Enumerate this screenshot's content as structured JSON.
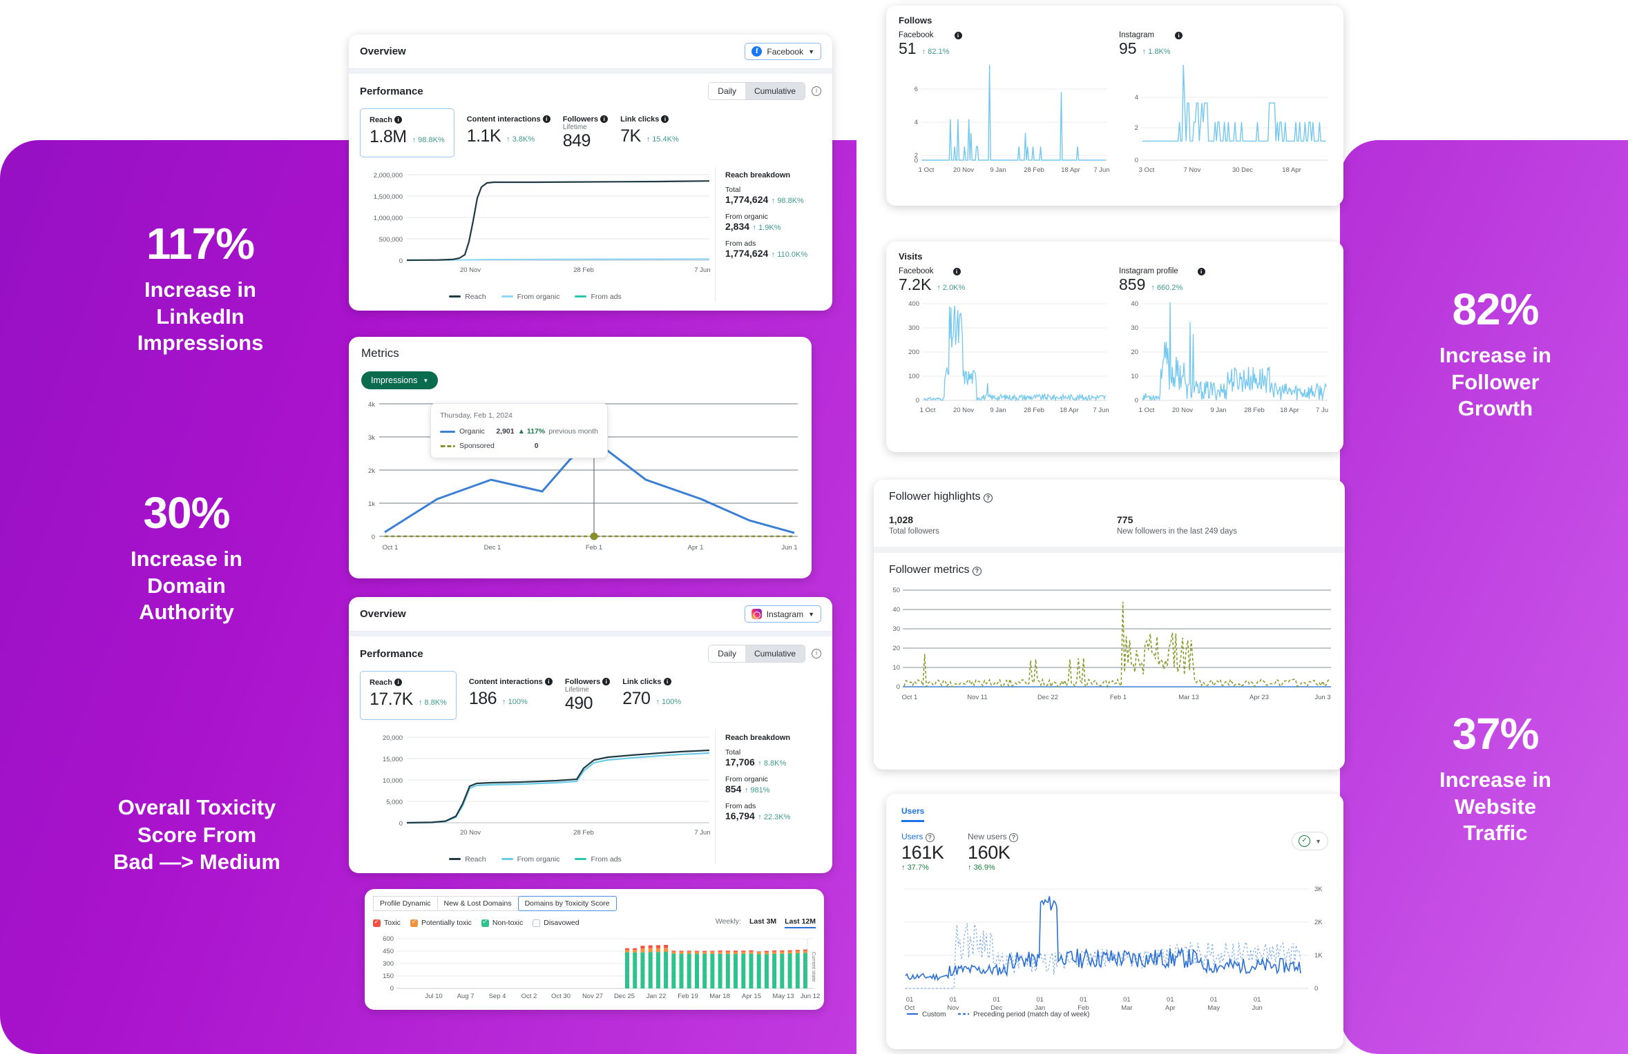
{
  "highlights": [
    {
      "id": "117",
      "big": "117%",
      "lines": [
        "Increase in",
        "LinkedIn",
        "Impressions"
      ]
    },
    {
      "id": "30",
      "big": "30%",
      "lines": [
        "Increase in",
        "Domain",
        "Authority"
      ]
    },
    {
      "id": "82",
      "big": "82%",
      "lines": [
        "Increase in",
        "Follower",
        "Growth"
      ]
    },
    {
      "id": "37",
      "big": "37%",
      "lines": [
        "Increase in",
        "Website",
        "Traffic"
      ]
    }
  ],
  "toxicity_statement": [
    "Overall Toxicity",
    "Score From",
    "Bad —> Medium"
  ],
  "facebook_overview": {
    "title": "Overview",
    "network": "Facebook",
    "section": "Performance",
    "toggle": {
      "daily": "Daily",
      "cumulative": "Cumulative",
      "active": "Cumulative"
    },
    "kpis": [
      {
        "label": "Reach",
        "sublabel": "",
        "value": "1.8M",
        "delta": "98.8K%"
      },
      {
        "label": "Content interactions",
        "sublabel": "",
        "value": "1.1K",
        "delta": "3.8K%"
      },
      {
        "label": "Followers",
        "sublabel": "Lifetime",
        "value": "849",
        "delta": ""
      },
      {
        "label": "Link clicks",
        "sublabel": "",
        "value": "7K",
        "delta": "15.4K%"
      }
    ],
    "breakdown": {
      "title": "Reach breakdown",
      "rows": [
        {
          "label": "Total",
          "value": "1,774,624",
          "delta": "98.8K%"
        },
        {
          "label": "From organic",
          "value": "2,834",
          "delta": "1.9K%"
        },
        {
          "label": "From ads",
          "value": "1,774,624",
          "delta": "110.0K%"
        }
      ]
    },
    "legend": [
      "Reach",
      "From organic",
      "From ads"
    ],
    "chart_data": {
      "type": "line",
      "title": "Reach (cumulative)",
      "xlabel": "",
      "ylabel": "",
      "yticks": [
        "0",
        "500,000",
        "1,000,000",
        "1,500,000",
        "2,000,000"
      ],
      "ylim": [
        0,
        2000000
      ],
      "xticks": [
        "20 Nov",
        "28 Feb",
        "7 Jun"
      ],
      "series": [
        {
          "name": "Reach",
          "color": "#1f3a42",
          "values": [
            2000,
            4000,
            7000,
            12000,
            18000,
            26000,
            40000,
            70000,
            420000,
            1060000,
            1420000,
            1600000,
            1700000,
            1742000,
            1745000,
            1746000,
            1748000,
            1750000,
            1752000,
            1754000,
            1756000,
            1758000,
            1760000,
            1762000,
            1764000,
            1766000,
            1768000,
            1770000,
            1772000,
            1774624
          ]
        },
        {
          "name": "From organic",
          "color": "#8ed6f7",
          "values": [
            100,
            160,
            230,
            300,
            380,
            460,
            540,
            640,
            760,
            900,
            1050,
            1200,
            1340,
            1470,
            1600,
            1720,
            1840,
            1960,
            2080,
            2180,
            2280,
            2380,
            2460,
            2540,
            2610,
            2670,
            2720,
            2770,
            2810,
            2834
          ]
        },
        {
          "name": "From ads",
          "color": "#2cc5b0",
          "values": [
            0,
            0,
            0,
            0,
            0,
            0,
            0,
            0,
            0,
            0,
            0,
            0,
            0,
            0,
            0,
            0,
            0,
            0,
            0,
            0,
            0,
            0,
            0,
            0,
            0,
            0,
            0,
            0,
            0,
            0
          ]
        }
      ]
    }
  },
  "metrics_card": {
    "title": "Metrics",
    "selector": "Impressions",
    "tooltip": {
      "date": "Thursday, Feb 1, 2024",
      "rows": [
        {
          "name": "Organic",
          "value": "2,901",
          "delta": "117%",
          "note": "previous month"
        },
        {
          "name": "Sponsored",
          "value": "0",
          "delta": "",
          "note": ""
        }
      ]
    },
    "chart_data": {
      "type": "line",
      "title": "Impressions",
      "yticks": [
        "0",
        "1k",
        "2k",
        "3k",
        "4k"
      ],
      "ylim": [
        0,
        4000
      ],
      "xticks": [
        "Oct 1",
        "Dec 1",
        "Feb 1",
        "Apr 1",
        "Jun 1"
      ],
      "x": [
        "Oct 1",
        "Nov 1",
        "Dec 1",
        "Jan 1",
        "Jan 15",
        "Feb 1",
        "Mar 1",
        "Apr 1",
        "May 1",
        "Jun 1"
      ],
      "series": [
        {
          "name": "Organic",
          "color": "#3b7fd4",
          "style": "solid",
          "values": [
            120,
            1130,
            1700,
            1350,
            2320,
            2901,
            1700,
            1200,
            600,
            170
          ]
        },
        {
          "name": "Sponsored",
          "color": "#8a8f2e",
          "style": "dashed",
          "values": [
            0,
            0,
            0,
            0,
            0,
            0,
            0,
            0,
            0,
            0
          ]
        }
      ]
    }
  },
  "instagram_overview": {
    "title": "Overview",
    "network": "Instagram",
    "section": "Performance",
    "toggle": {
      "daily": "Daily",
      "cumulative": "Cumulative",
      "active": "Cumulative"
    },
    "kpis": [
      {
        "label": "Reach",
        "sublabel": "",
        "value": "17.7K",
        "delta": "8.8K%"
      },
      {
        "label": "Content interactions",
        "sublabel": "",
        "value": "186",
        "delta": "100%"
      },
      {
        "label": "Followers",
        "sublabel": "Lifetime",
        "value": "490",
        "delta": ""
      },
      {
        "label": "Link clicks",
        "sublabel": "",
        "value": "270",
        "delta": "100%"
      }
    ],
    "breakdown": {
      "title": "Reach breakdown",
      "rows": [
        {
          "label": "Total",
          "value": "17,706",
          "delta": "8.8K%"
        },
        {
          "label": "From organic",
          "value": "854",
          "delta": "981%"
        },
        {
          "label": "From ads",
          "value": "16,794",
          "delta": "22.3K%"
        }
      ]
    },
    "legend": [
      "Reach",
      "From organic",
      "From ads"
    ],
    "chart_data": {
      "type": "line",
      "title": "Reach (cumulative)",
      "yticks": [
        "0",
        "5,000",
        "10,000",
        "15,000",
        "20,000"
      ],
      "ylim": [
        0,
        20000
      ],
      "xticks": [
        "20 Nov",
        "28 Feb",
        "7 Jun"
      ],
      "series": [
        {
          "name": "Reach",
          "color": "#1f3a42",
          "values": [
            20,
            60,
            160,
            420,
            1800,
            6800,
            9200,
            9600,
            9800,
            9950,
            10100,
            10300,
            10500,
            10800,
            11100,
            11500,
            13600,
            15200,
            16000,
            16400,
            16800,
            17000,
            17200,
            17350,
            17450,
            17550,
            17620,
            17660,
            17690,
            17706
          ]
        },
        {
          "name": "From organic",
          "color": "#6ecbe8",
          "values": [
            10,
            35,
            110,
            330,
            1450,
            6100,
            8400,
            8700,
            8900,
            9000,
            9150,
            9300,
            9450,
            9700,
            10000,
            10350,
            12600,
            14200,
            14900,
            15300,
            15700,
            15900,
            16100,
            16250,
            16350,
            16450,
            16520,
            16560,
            16590,
            16620
          ]
        },
        {
          "name": "From ads",
          "color": "#2cc5b0",
          "values": [
            0,
            0,
            0,
            0,
            0,
            0,
            0,
            0,
            0,
            0,
            0,
            0,
            0,
            0,
            0,
            0,
            0,
            0,
            0,
            0,
            0,
            0,
            0,
            0,
            0,
            0,
            0,
            0,
            0,
            0
          ]
        }
      ]
    }
  },
  "toxicity_card": {
    "tabs": [
      "Profile Dynamic",
      "New & Lost Domains",
      "Domains by Toxicity Score"
    ],
    "active_tab": "Domains by Toxicity Score",
    "legend": [
      {
        "label": "Toxic",
        "color": "#f3513f",
        "checked": true
      },
      {
        "label": "Potentially toxic",
        "color": "#f4913e",
        "checked": true
      },
      {
        "label": "Non-toxic",
        "color": "#2ec38c",
        "checked": true
      },
      {
        "label": "Disavowed",
        "color": "#ffffff",
        "checked": false
      }
    ],
    "range_label": "Weekly:",
    "ranges": [
      "Last 3M",
      "Last 12M"
    ],
    "active_range": "Last 12M",
    "current_state_label": "Current state",
    "chart_data": {
      "type": "bar",
      "title": "Domains by Toxicity Score",
      "yticks": [
        "0",
        "150",
        "300",
        "450",
        "600"
      ],
      "ylim": [
        0,
        600
      ],
      "xticks": [
        "Jul 10",
        "Aug 7",
        "Sep 4",
        "Oct 2",
        "Oct 30",
        "Nov 27",
        "Dec 25",
        "Jan 22",
        "Feb 19",
        "Mar 18",
        "Apr 15",
        "May 13",
        "Jun 12"
      ],
      "stacked": true,
      "series": [
        {
          "name": "Toxic",
          "color": "#f3513f",
          "values": [
            18,
            20,
            32,
            34,
            34,
            36,
            12,
            12,
            12,
            12,
            12,
            12,
            14,
            14,
            14,
            14,
            14,
            6,
            14,
            14,
            14,
            14,
            14,
            14
          ]
        },
        {
          "name": "Potentially toxic",
          "color": "#f4913e",
          "values": [
            30,
            32,
            48,
            48,
            48,
            48,
            24,
            24,
            24,
            24,
            24,
            24,
            26,
            26,
            26,
            26,
            26,
            26,
            26,
            26,
            26,
            26,
            26,
            28
          ]
        },
        {
          "name": "Non-toxic",
          "color": "#2ec38c",
          "values": [
            437,
            433,
            435,
            438,
            440,
            442,
            420,
            419,
            420,
            418,
            417,
            418,
            418,
            416,
            416,
            417,
            420,
            415,
            413,
            418,
            419,
            421,
            425,
            428
          ]
        }
      ]
    }
  },
  "follows_card": {
    "title": "Follows",
    "panels": [
      {
        "name": "Facebook",
        "value": "51",
        "delta": "82.1%",
        "chart_data": {
          "type": "line",
          "yticks": [
            "0",
            "2",
            "4",
            "6"
          ],
          "ylim": [
            0,
            7
          ],
          "xticks": [
            "1 Oct",
            "20 Nov",
            "9 Jan",
            "28 Feb",
            "18 Apr",
            "7 Jun"
          ],
          "color": "#74c8f0",
          "peaks": "sparse spikes, max 7 near Dec, 5 near 18 Apr"
        }
      },
      {
        "name": "Instagram",
        "value": "95",
        "delta": "1.8K%",
        "chart_data": {
          "type": "line",
          "yticks": [
            "0",
            "2",
            "4"
          ],
          "ylim": [
            0,
            5
          ],
          "xticks": [
            "3 Oct",
            "7 Nov",
            "30 Dec",
            "18 Apr"
          ],
          "color": "#74c8f0",
          "peaks": "baseline 1, spikes to 5 near late Oct, frequent 2–3"
        }
      }
    ]
  },
  "visits_card": {
    "title": "Visits",
    "panels": [
      {
        "name": "Facebook",
        "value": "7.2K",
        "delta": "2.0K%",
        "chart_data": {
          "type": "line",
          "yticks": [
            "0",
            "100",
            "200",
            "300",
            "400"
          ],
          "ylim": [
            0,
            400
          ],
          "xticks": [
            "1 Oct",
            "20 Nov",
            "9 Jan",
            "28 Feb",
            "18 Apr",
            "7 Jun"
          ],
          "color": "#74c8f0",
          "peaks": "burst to ~390 mid Nov, decays to low noise"
        }
      },
      {
        "name": "Instagram profile",
        "value": "859",
        "delta": "660.2%",
        "chart_data": {
          "type": "line",
          "yticks": [
            "0",
            "10",
            "20",
            "30",
            "40"
          ],
          "ylim": [
            0,
            40
          ],
          "xticks": [
            "1 Oct",
            "20 Nov",
            "9 Jan",
            "28 Feb",
            "18 Apr",
            "7 Ju"
          ],
          "color": "#74c8f0",
          "peaks": "spikes to 40 and 32 around Nov, sustained 5-14 later"
        }
      }
    ]
  },
  "follower_card": {
    "highlights_title": "Follower highlights",
    "stats": [
      {
        "value": "1,028",
        "label": "Total followers"
      },
      {
        "value": "775",
        "label": "New followers in the last 249 days"
      }
    ],
    "metrics_title": "Follower metrics",
    "chart_data": {
      "type": "line",
      "title": "Follower metrics",
      "yticks": [
        "0",
        "10",
        "20",
        "30",
        "40",
        "50"
      ],
      "ylim": [
        0,
        50
      ],
      "xticks": [
        "Oct 1",
        "Nov 11",
        "Dec 22",
        "Feb 1",
        "Mar 13",
        "Apr 23",
        "Jun 3"
      ],
      "series": [
        {
          "name": "New followers",
          "color": "#8a9b2e",
          "style": "dashed",
          "peak": 44,
          "peak_at": "late Jan",
          "values": [
            1,
            2,
            17,
            1,
            2,
            1,
            3,
            2,
            4,
            2,
            3,
            1,
            2,
            1,
            2,
            10,
            3,
            6,
            14,
            7,
            14,
            10,
            6,
            3,
            2,
            1,
            2,
            1,
            44,
            20,
            29,
            12,
            9,
            26,
            8,
            24,
            19,
            6,
            3,
            4,
            2,
            3,
            2,
            1,
            2,
            3,
            1,
            2,
            1,
            2,
            5,
            3,
            1,
            1
          ]
        }
      ]
    }
  },
  "ga_card": {
    "tab": "Users",
    "metrics": [
      {
        "label": "Users",
        "value": "161K",
        "delta": "37.7%"
      },
      {
        "label": "New users",
        "value": "160K",
        "delta": "36.9%"
      }
    ],
    "chart_data": {
      "type": "line",
      "yticks": [
        "0",
        "1K",
        "2K",
        "3K"
      ],
      "ylim": [
        0,
        3000
      ],
      "xticks": [
        {
          "day": "01",
          "month": "Oct"
        },
        {
          "day": "01",
          "month": "Nov"
        },
        {
          "day": "01",
          "month": "Dec"
        },
        {
          "day": "01",
          "month": "Jan"
        },
        {
          "day": "01",
          "month": "Feb"
        },
        {
          "day": "01",
          "month": "Mar"
        },
        {
          "day": "01",
          "month": "Apr"
        },
        {
          "day": "01",
          "month": "May"
        },
        {
          "day": "01",
          "month": "Jun"
        }
      ],
      "series": [
        {
          "name": "Custom",
          "color": "#2b6fd6",
          "style": "solid",
          "values": [
            350,
            420,
            300,
            520,
            600,
            480,
            540,
            700,
            620,
            900,
            1050,
            980,
            1200,
            1100,
            2650,
            2700,
            2500,
            2720,
            2600,
            1000,
            900,
            800,
            850,
            780,
            820,
            760,
            900,
            1100,
            1000,
            1150,
            980,
            1050,
            900,
            880,
            820,
            760,
            700,
            650,
            600,
            560
          ]
        },
        {
          "name": "Preceding period (match day of week)",
          "color": "#7aa7e8",
          "style": "dashed",
          "values": [
            0,
            0,
            0,
            0,
            1400,
            1900,
            1300,
            1100,
            700,
            500,
            400,
            380,
            350,
            900,
            1100,
            1400,
            1300,
            1000,
            900,
            820,
            760,
            700,
            680,
            650,
            700,
            900,
            1100,
            1300,
            1200,
            1100,
            1000,
            950,
            900,
            880,
            860,
            840,
            820,
            800,
            780,
            760
          ]
        }
      ],
      "legend": [
        "Custom",
        "Preceding period (match day of week)"
      ]
    }
  }
}
